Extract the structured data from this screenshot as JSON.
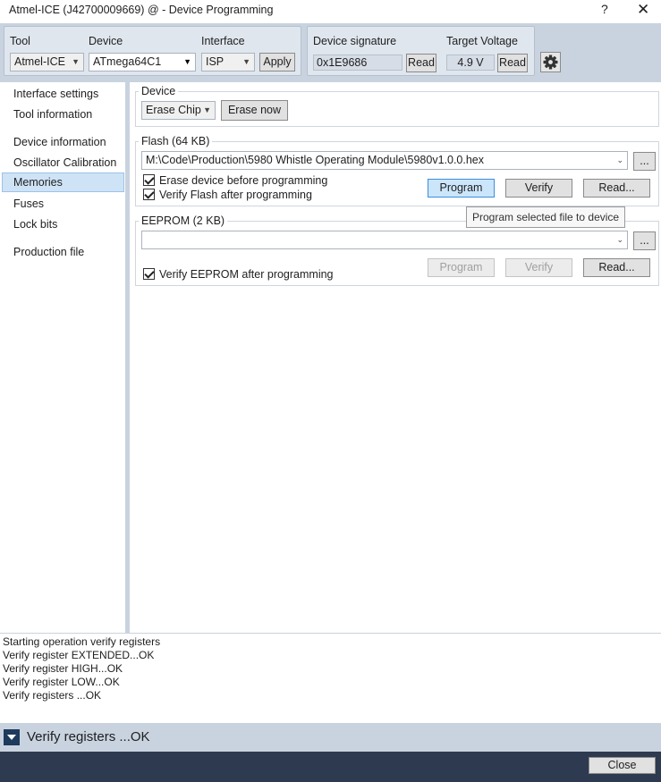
{
  "window": {
    "title": "Atmel-ICE (J42700009669) @  - Device Programming",
    "help_label": "?",
    "close_label": "✕"
  },
  "toolbar": {
    "tool_label": "Tool",
    "tool_value": "Atmel-ICE",
    "device_label": "Device",
    "device_value": "ATmega64C1",
    "interface_label": "Interface",
    "interface_value": "ISP",
    "apply_label": "Apply",
    "signature_label": "Device signature",
    "signature_value": "0x1E9686",
    "signature_read_label": "Read",
    "voltage_label": "Target Voltage",
    "voltage_value": "4.9 V",
    "voltage_read_label": "Read",
    "settings_icon": "gear-icon"
  },
  "sidebar": {
    "items": [
      {
        "label": "Interface settings"
      },
      {
        "label": "Tool information"
      },
      {
        "label": "Device information"
      },
      {
        "label": "Oscillator Calibration"
      },
      {
        "label": "Memories",
        "selected": true
      },
      {
        "label": "Fuses"
      },
      {
        "label": "Lock bits"
      },
      {
        "label": "Production file"
      }
    ]
  },
  "device_section": {
    "label": "Device",
    "erase_combo_value": "Erase Chip",
    "erase_now_label": "Erase now"
  },
  "flash_section": {
    "label": "Flash (64 KB)",
    "file_path": "M:\\Code\\Production\\5980 Whistle Operating Module\\5980v1.0.0.hex",
    "browse_label": "...",
    "erase_before_label": "Erase device before programming",
    "erase_before_checked": true,
    "verify_after_label": "Verify Flash after programming",
    "verify_after_checked": true,
    "program_label": "Program",
    "verify_label": "Verify",
    "read_label": "Read..."
  },
  "tooltip": {
    "text": "Program selected file to device"
  },
  "eeprom_section": {
    "label": "EEPROM (2 KB)",
    "file_path": "",
    "browse_label": "...",
    "verify_after_label": "Verify EEPROM after programming",
    "verify_after_checked": true,
    "program_label": "Program",
    "verify_label": "Verify",
    "read_label": "Read..."
  },
  "log": {
    "lines": [
      "Starting operation verify registers",
      "Verify register EXTENDED...OK",
      "Verify register HIGH...OK",
      "Verify register LOW...OK",
      "Verify registers ...OK"
    ]
  },
  "status": {
    "message": "Verify registers ...OK"
  },
  "footer": {
    "close_label": "Close"
  }
}
